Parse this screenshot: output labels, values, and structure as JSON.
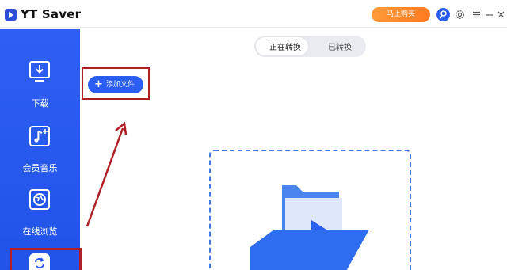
{
  "app": {
    "title": "YT Saver"
  },
  "titlebar": {
    "buy_label": "马上购买",
    "icons": [
      "user-icon",
      "settings-icon",
      "menu-icon",
      "minimize-icon",
      "close-icon"
    ]
  },
  "sidebar": {
    "items": [
      {
        "label": "下载",
        "icon": "download-icon"
      },
      {
        "label": "会员音乐",
        "icon": "music-icon"
      },
      {
        "label": "在线浏览",
        "icon": "browser-icon"
      },
      {
        "label": "",
        "icon": "convert-icon",
        "selected": true
      }
    ]
  },
  "tabs": {
    "converting": "正在转换",
    "converted": "已转换",
    "active": "converting"
  },
  "toolbar": {
    "add_file_label": "添加文件",
    "add_icon": "plus-icon"
  },
  "dropzone": {
    "icon": "video-folder-icon"
  },
  "colors": {
    "sidebar_blue": "#2153e8",
    "accent_blue": "#2a5ef0",
    "buy_orange": "#ff7a1f",
    "annotation_red": "#b01f24"
  }
}
